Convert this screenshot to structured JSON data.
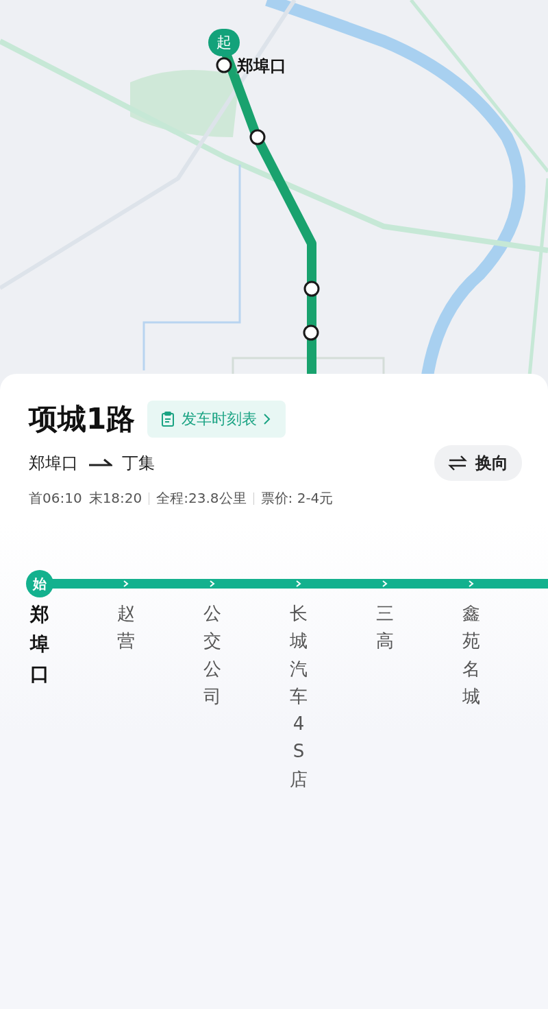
{
  "map": {
    "start_badge": "起",
    "start_label": "郑埠口"
  },
  "route": {
    "name": "项城1路",
    "timetable_button": "发车时刻表",
    "from": "郑埠口",
    "to": "丁集",
    "swap_button": "换向",
    "first_bus": "首06:10",
    "last_bus": "末18:20",
    "distance": "全程:23.8公里",
    "fare": "票价: 2-4元"
  },
  "line": {
    "start_badge": "始",
    "stops": [
      {
        "name": "郑埠口",
        "selected": true
      },
      {
        "name": "赵营",
        "selected": false
      },
      {
        "name": "公交公司",
        "selected": false
      },
      {
        "name": "长城汽车4S店",
        "selected": false
      },
      {
        "name": "三高",
        "selected": false
      },
      {
        "name": "鑫苑名城",
        "selected": false
      }
    ]
  }
}
